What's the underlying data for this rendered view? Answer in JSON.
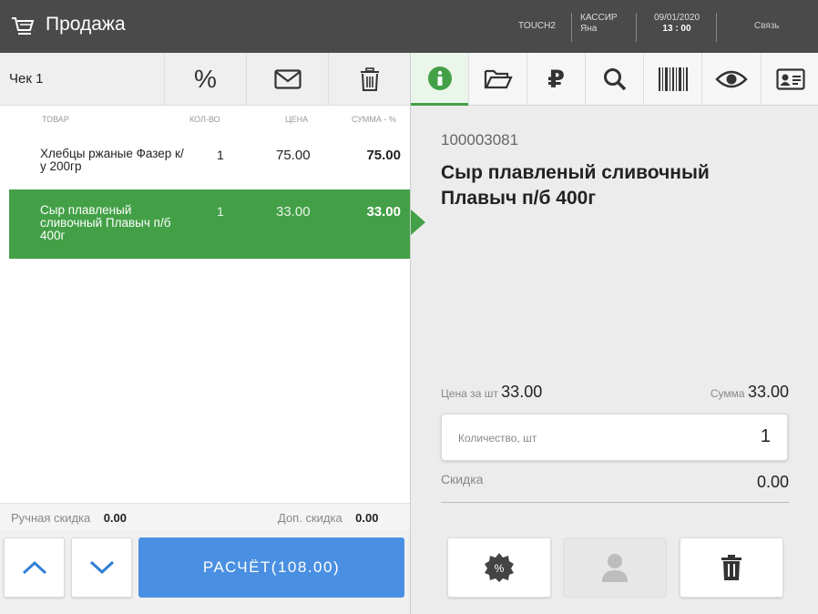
{
  "header": {
    "title": "Продажа",
    "terminal": "TOUCH2",
    "cashier_label": "КАССИР",
    "cashier_name": "Яна",
    "date": "09/01/2020",
    "time": "13 : 00",
    "link": "Связь",
    "icon": "cart-icon"
  },
  "check": {
    "title": "Чек 1",
    "buttons": [
      {
        "name": "percent-icon"
      },
      {
        "name": "envelope-icon"
      },
      {
        "name": "trash-icon"
      }
    ],
    "columns": [
      "ТОВАР",
      "КОЛ-ВО",
      "ЦЕНА",
      "СУММА - %"
    ],
    "rows": [
      {
        "name": "Хлебцы ржаные Фазер к/у 200гр",
        "qty": "1",
        "price": "75.00",
        "sum": "75.00",
        "selected": false
      },
      {
        "name": "Сыр плавленый сливочный Плавыч п/б 400г",
        "qty": "1",
        "price": "33.00",
        "sum": "33.00",
        "selected": true
      }
    ],
    "manual_discount_label": "Ручная скидка",
    "manual_discount_value": "0.00",
    "extra_discount_label": "Доп. скидка",
    "extra_discount_value": "0.00",
    "pay_label": "РАСЧЁТ(108.00)"
  },
  "tabs": [
    {
      "name": "info-icon",
      "active": true
    },
    {
      "name": "folder-icon",
      "active": false
    },
    {
      "name": "ruble-icon",
      "active": false
    },
    {
      "name": "search-icon",
      "active": false
    },
    {
      "name": "barcode-icon",
      "active": false
    },
    {
      "name": "eye-icon",
      "active": false
    },
    {
      "name": "contact-card-icon",
      "active": false
    }
  ],
  "detail": {
    "code": "100003081",
    "name": "Сыр плавленый сливочный Плавыч п/б 400г",
    "unit_price_label": "Цена за шт",
    "unit_price": "33.00",
    "sum_label": "Сумма",
    "sum": "33.00",
    "qty_label": "Количество, шт",
    "qty": "1",
    "discount_label": "Скидка",
    "discount": "0.00"
  },
  "colors": {
    "accent_green": "#43a047",
    "pay_blue": "#4a90e2",
    "header_bg": "#4a4a4a",
    "arrow_blue": "#2f7fd6"
  }
}
